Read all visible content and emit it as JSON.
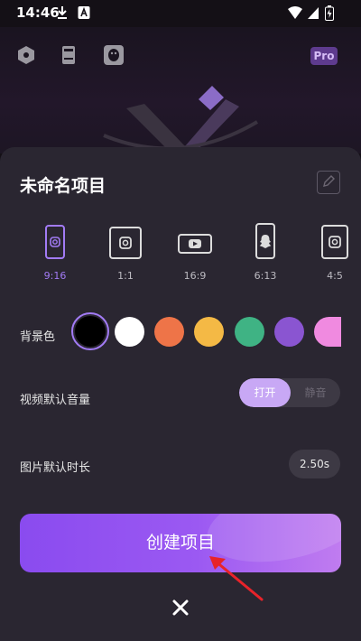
{
  "status_bar": {
    "time": "14:46",
    "icons": [
      "download-icon",
      "a-badge-icon",
      "wifi-icon",
      "signal-icon",
      "battery-icon"
    ]
  },
  "background_app": {
    "top_icons": [
      "hexagon-icon",
      "phone-icon",
      "qq-icon"
    ],
    "pro_badge": "Pro"
  },
  "sheet": {
    "title": "未命名项目",
    "edit_icon": "pencil-icon",
    "ratios": [
      {
        "label": "9:16",
        "icon": "instagram-icon",
        "selected": true
      },
      {
        "label": "1:1",
        "icon": "instagram-icon",
        "selected": false
      },
      {
        "label": "16:9",
        "icon": "youtube-icon",
        "selected": false
      },
      {
        "label": "6:13",
        "icon": "snapchat-icon",
        "selected": false
      },
      {
        "label": "4:5",
        "icon": "instagram-icon",
        "selected": false
      }
    ],
    "background_color": {
      "label": "背景色",
      "swatches": [
        "#000000",
        "#ffffff",
        "#ee7448",
        "#f4b945",
        "#3fb384",
        "#8a55d1",
        "#f08ae0"
      ],
      "selected_index": 0
    },
    "video_volume": {
      "label": "视频默认音量",
      "on_label": "打开",
      "off_label": "静音",
      "value": "打开"
    },
    "image_duration": {
      "label": "图片默认时长",
      "value": "2.50s"
    },
    "create_button": "创建项目",
    "close_icon": "close-icon",
    "annotation": "red-arrow-pointer"
  },
  "colors": {
    "accent": "#a27bf5",
    "sheet_bg": "#2a2631",
    "button_start": "#8a4bef",
    "button_end": "#c07cf0",
    "arrow": "#e8232a"
  }
}
